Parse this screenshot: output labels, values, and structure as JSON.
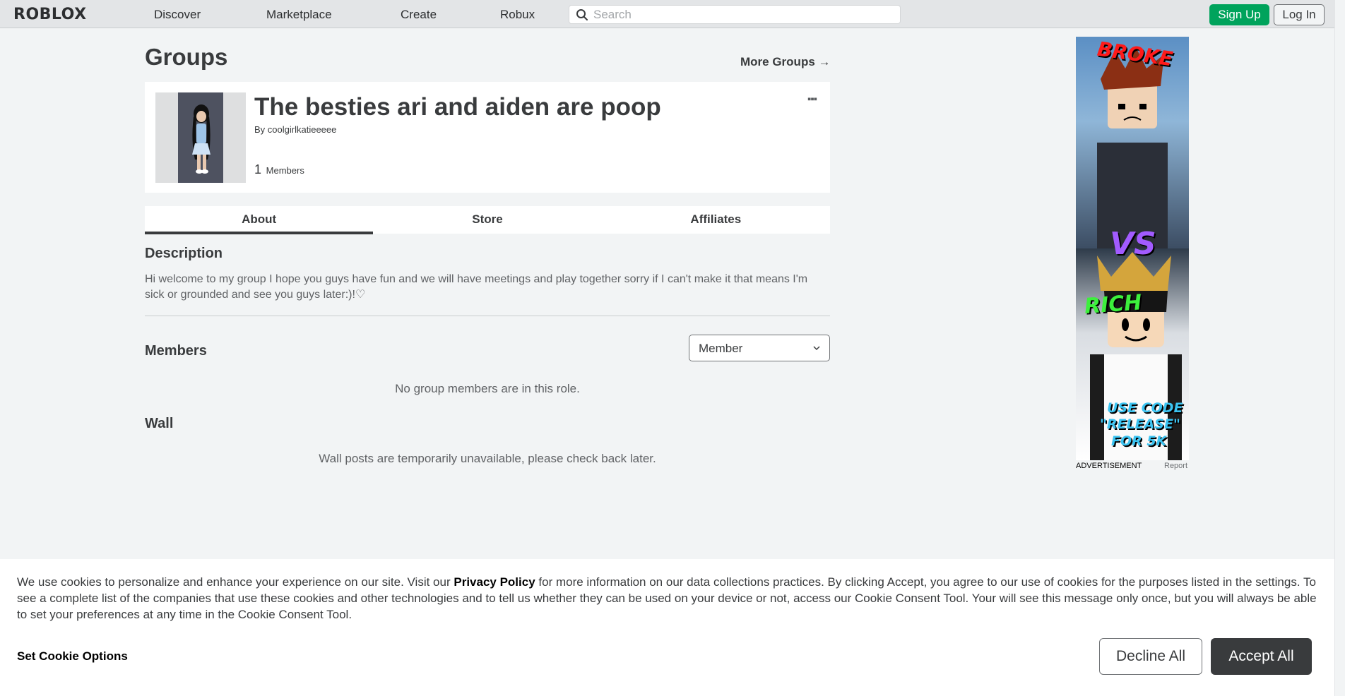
{
  "header": {
    "logo": "RΟBLOX",
    "nav": [
      "Discover",
      "Marketplace",
      "Create",
      "Robux"
    ],
    "search_placeholder": "Search",
    "signup": "Sign Up",
    "login": "Log In"
  },
  "page": {
    "title": "Groups",
    "more_groups": "More Groups →"
  },
  "group": {
    "name": "The besties ari and aiden are poop",
    "by_label": "By",
    "owner": "coolgirlkatieeeee",
    "member_count": "1",
    "members_label": "Members",
    "more_icon": "▪▪▪"
  },
  "tabs": [
    "About",
    "Store",
    "Affiliates"
  ],
  "about": {
    "description_heading": "Description",
    "description": "Hi welcome to my group I hope you guys have fun and we will have meetings and play together sorry if I can't make it that means I'm sick or grounded and see you guys later:)!♡",
    "members_heading": "Members",
    "role_selected": "Member",
    "no_members": "No group members are in this role.",
    "wall_heading": "Wall",
    "wall_message": "Wall posts are temporarily unavailable, please check back later."
  },
  "ad": {
    "text_top": "BROKE",
    "text_vs": "VS",
    "text_rich": "RICH",
    "text_code1": "USE CODE",
    "text_code2": "\"RELEASE\"",
    "text_code3": "FOR 5K",
    "label": "ADVERTISEMENT",
    "report": "Report"
  },
  "cookie": {
    "text_before": "We use cookies to personalize and enhance your experience on our site. Visit our ",
    "privacy_link": "Privacy Policy",
    "text_after": " for more information on our data collections practices. By clicking Accept, you agree to our use of cookies for the purposes listed in the settings. To see a complete list of the companies that use these cookies and other technologies and to tell us whether they can be used on your device or not, access our Cookie Consent Tool. Your will see this message only once, but you will always be able to set your preferences at any time in the Cookie Consent Tool.",
    "set_options": "Set Cookie Options",
    "decline": "Decline All",
    "accept": "Accept All"
  },
  "colors": {
    "signup_green": "#00a35c",
    "accept_dark": "#393b3d",
    "page_bg": "#f2f4f5"
  }
}
